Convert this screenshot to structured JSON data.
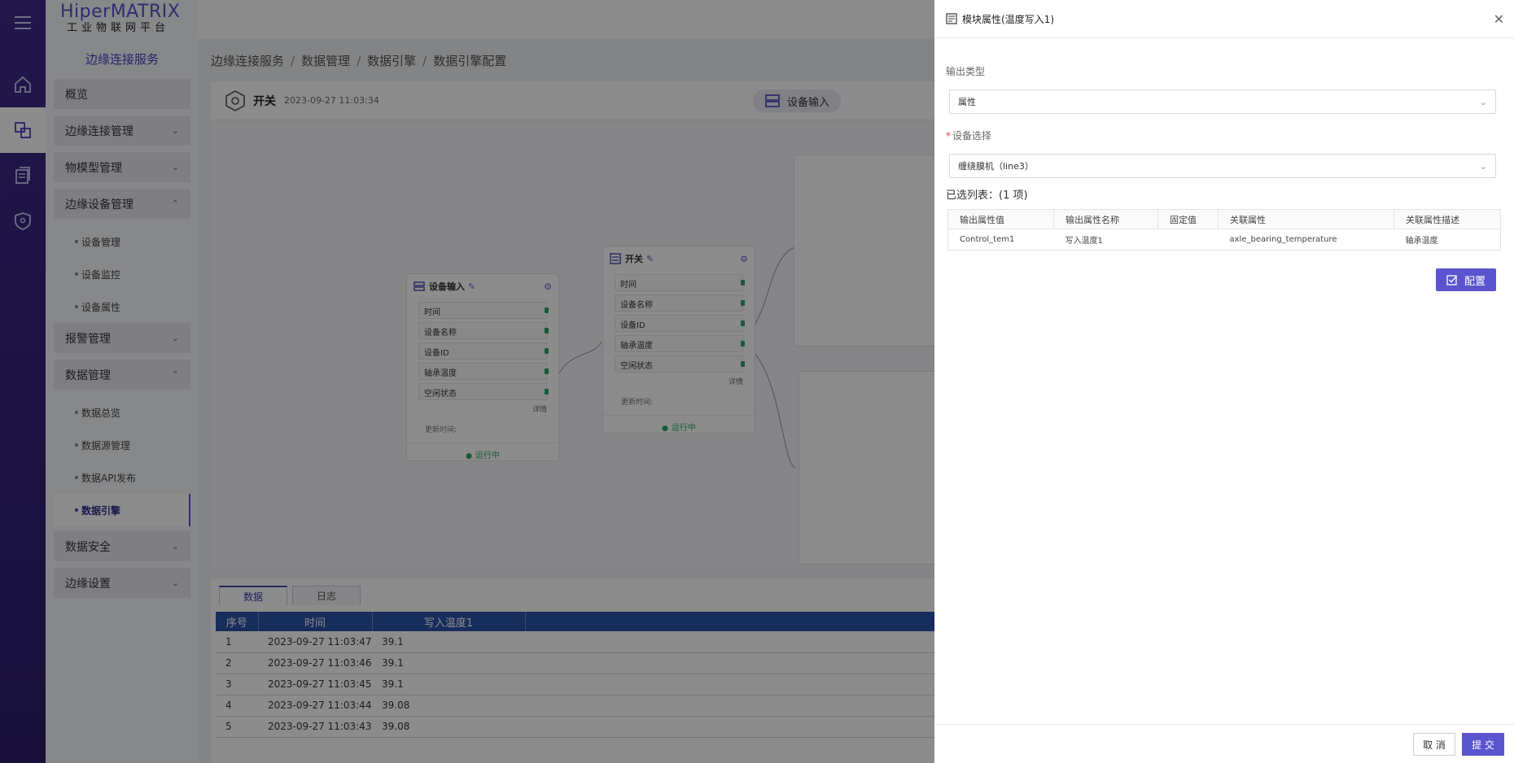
{
  "app": {
    "logo_top": "HiperMATRIX",
    "logo_bottom": "工业物联网平台"
  },
  "rail": {
    "items": [
      "menu-icon",
      "home-icon",
      "edge-icon",
      "document-icon",
      "shield-icon"
    ]
  },
  "sidebar": {
    "title": "边缘连接服务",
    "overview": "概览",
    "edge_conn": "边缘连接管理",
    "model": "物模型管理",
    "device_mgmt": "边缘设备管理",
    "device_sub": [
      "设备管理",
      "设备监控",
      "设备属性"
    ],
    "alarm": "报警管理",
    "data_mgmt": "数据管理",
    "data_sub": [
      "数据总览",
      "数据源管理",
      "数据API发布",
      "数据引擎"
    ],
    "data_security": "数据安全",
    "edge_settings": "边缘设置"
  },
  "breadcrumb": [
    "边缘连接服务",
    "数据管理",
    "数据引擎",
    "数据引擎配置"
  ],
  "canvas": {
    "name": "开关",
    "timestamp": "2023-09-27 11:03:34",
    "head_button": "设备输入",
    "node1": {
      "title": "设备输入",
      "fields": [
        "时间",
        "设备名称",
        "设备ID",
        "轴承温度",
        "空闲状态"
      ],
      "detail": "详情",
      "update": "更新时间:",
      "status": "运行中"
    },
    "node2": {
      "title": "开关",
      "fields": [
        "时间",
        "设备名称",
        "设备ID",
        "轴承温度",
        "空闲状态"
      ],
      "detail": "详情",
      "update": "更新时间:",
      "status": "运行中"
    }
  },
  "bottom": {
    "tabs": [
      "数据",
      "日志"
    ],
    "columns": [
      "序号",
      "时间",
      "写入温度1"
    ],
    "rows": [
      [
        "1",
        "2023-09-27 11:03:47",
        "39.1"
      ],
      [
        "2",
        "2023-09-27 11:03:46",
        "39.1"
      ],
      [
        "3",
        "2023-09-27 11:03:45",
        "39.1"
      ],
      [
        "4",
        "2023-09-27 11:03:44",
        "39.08"
      ],
      [
        "5",
        "2023-09-27 11:03:43",
        "39.08"
      ]
    ]
  },
  "drawer": {
    "title": "模块属性(温度写入1)",
    "output_type_label": "输出类型",
    "output_type_value": "属性",
    "device_label": "设备选择",
    "device_value": "缠绕膜机（line3）",
    "selected_count": "已选列表：(1 项)",
    "table": {
      "columns": [
        "输出属性值",
        "输出属性名称",
        "固定值",
        "关联属性",
        "关联属性描述"
      ],
      "row": [
        "Control_tem1",
        "写入温度1",
        "",
        "axle_bearing_temperature",
        "轴承温度"
      ]
    },
    "config_button": "配置",
    "cancel_button": "取 消",
    "submit_button": "提 交"
  },
  "colors": {
    "accent": "#5a55cf",
    "rail": "#35247a",
    "table_head": "#2a52a8",
    "running": "#25a35f"
  }
}
